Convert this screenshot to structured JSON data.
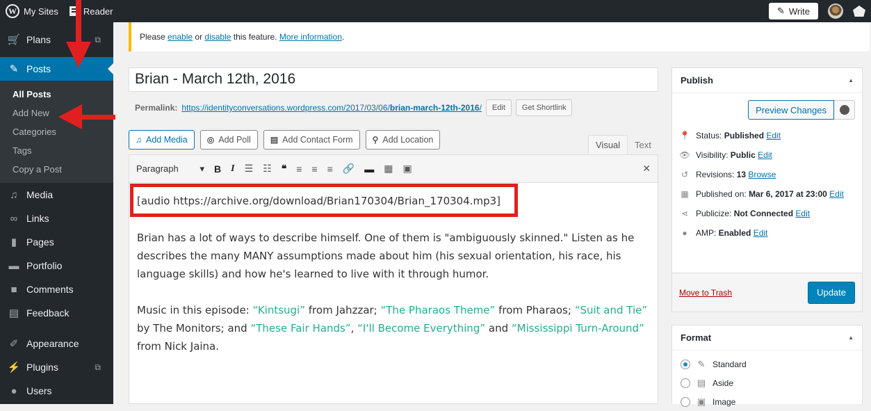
{
  "adminbar": {
    "my_sites": "My Sites",
    "reader": "Reader",
    "write": "Write"
  },
  "sidebar": {
    "items_top": [
      {
        "label": "Plans",
        "icon": "cart-icon"
      },
      {
        "label": "Posts",
        "icon": "pin-icon"
      }
    ],
    "posts_submenu": [
      "All Posts",
      "Add New",
      "Categories",
      "Tags",
      "Copy a Post"
    ],
    "items_bottom": [
      {
        "label": "Media",
        "icon": "media-icon"
      },
      {
        "label": "Links",
        "icon": "links-icon"
      },
      {
        "label": "Pages",
        "icon": "pages-icon"
      },
      {
        "label": "Portfolio",
        "icon": "portfolio-icon"
      },
      {
        "label": "Comments",
        "icon": "comments-icon"
      },
      {
        "label": "Feedback",
        "icon": "feedback-icon"
      },
      {
        "label": "Appearance",
        "icon": "appearance-icon"
      },
      {
        "label": "Plugins",
        "icon": "plugins-icon"
      },
      {
        "label": "Users",
        "icon": "users-icon"
      }
    ]
  },
  "notice": {
    "prefix": "Please ",
    "enable": "enable",
    "or": " or ",
    "disable": "disable",
    "middle": " this feature. ",
    "more": "More information",
    "end": "."
  },
  "post": {
    "title": "Brian - March 12th, 2016",
    "permalink_label": "Permalink:",
    "permalink_base": "https://identityconversations.wordpress.com/2017/03/06/",
    "permalink_slug": "brian-march-12th-2016",
    "permalink_end": "/",
    "edit": "Edit",
    "shortlink": "Get Shortlink"
  },
  "media_buttons": [
    "Add Media",
    "Add Poll",
    "Add Contact Form",
    "Add Location"
  ],
  "tabs": {
    "visual": "Visual",
    "text": "Text"
  },
  "toolbar": {
    "format": "Paragraph"
  },
  "content": {
    "shortcode": "[audio https://archive.org/download/Brian170304/Brian_170304.mp3]",
    "para1": "Brian has a lot of ways to describe himself. One of them is \"ambiguously skinned.\" Listen as he describes the many MANY assumptions made about him (his sexual orientation, his race, his language skills) and how he's learned to live with it through humor.",
    "music": {
      "t1": "Music in this episode: ",
      "s1": "“Kintsugi”",
      "t2": " from Jahzzar; ",
      "s2": "“The Pharaos Theme”",
      "t3": " from Pharaos; ",
      "s3": "“Suit and Tie”",
      "t4": " by The Monitors; and ",
      "s4": "“These Fair Hands”",
      "t5": ", ",
      "s5": "“I'll Become Everything”",
      "t6": " and ",
      "s6": "“Mississippi Turn-Around”",
      "t7": " from Nick Jaina."
    },
    "song_color": "#26ad8d"
  },
  "publish": {
    "title": "Publish",
    "preview": "Preview Changes",
    "status_label": "Status: ",
    "status": "Published",
    "visibility_label": "Visibility: ",
    "visibility": "Public",
    "revisions_label": "Revisions: ",
    "revisions": "13",
    "browse": "Browse",
    "published_label": "Published on: ",
    "published": "Mar 6, 2017 at 23:00",
    "publicize_label": "Publicize: ",
    "publicize": "Not Connected",
    "amp_label": "AMP: ",
    "amp": "Enabled",
    "edit": "Edit",
    "trash": "Move to Trash",
    "update": "Update"
  },
  "format": {
    "title": "Format",
    "options": [
      {
        "label": "Standard",
        "selected": true
      },
      {
        "label": "Aside",
        "selected": false
      },
      {
        "label": "Image",
        "selected": false
      }
    ]
  },
  "colors": {
    "accent": "#0073aa",
    "annotation_red": "#e02020",
    "sidebar": "#23282d"
  }
}
